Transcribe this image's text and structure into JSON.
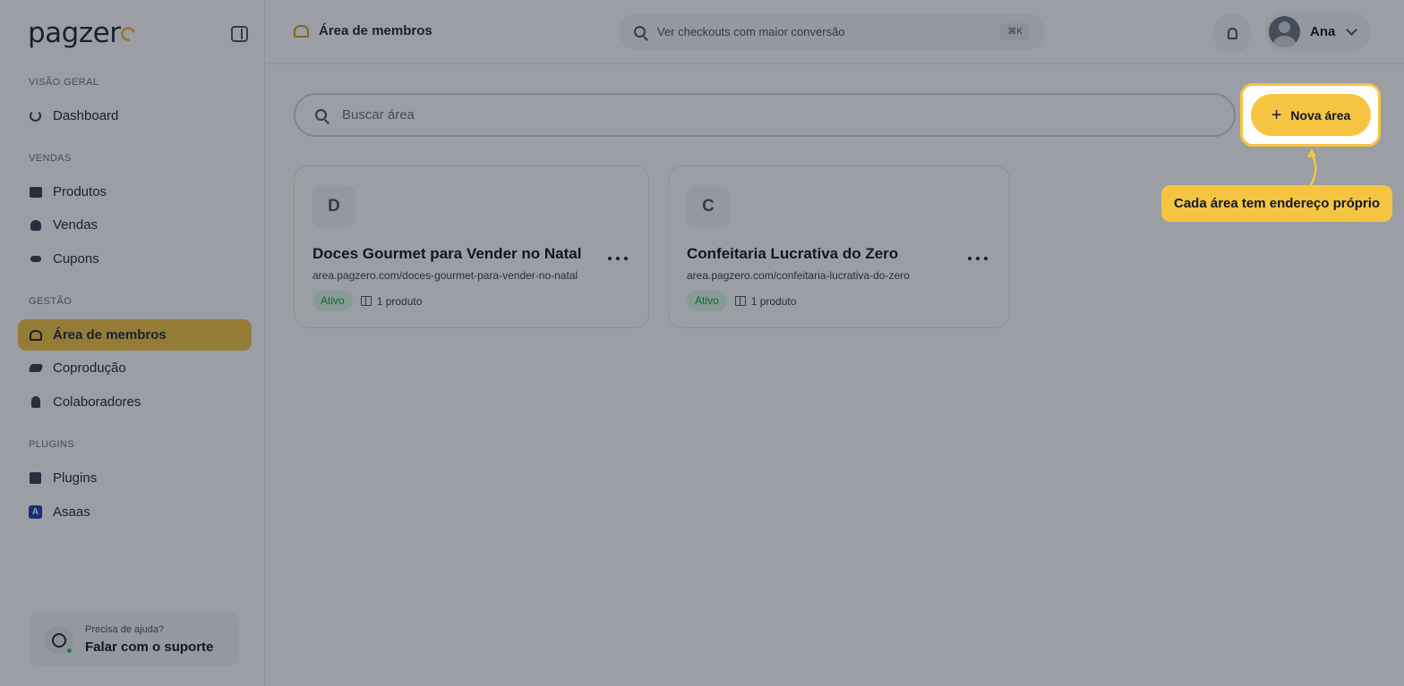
{
  "brand": {
    "logo_text": "pagzer",
    "accent_color": "#f5c542"
  },
  "sidebar": {
    "sections": {
      "overview": "VISÃO GERAL",
      "sales": "VENDAS",
      "management": "GESTÃO",
      "plugins": "PLUGINS"
    },
    "items": [
      {
        "label": "Dashboard",
        "icon": "chart-pie-icon"
      },
      {
        "label": "Produtos",
        "icon": "box-icon"
      },
      {
        "label": "Vendas",
        "icon": "sales-icon"
      },
      {
        "label": "Cupons",
        "icon": "ticket-icon"
      },
      {
        "label": "Área de membros",
        "icon": "users-icon",
        "active": true
      },
      {
        "label": "Coprodução",
        "icon": "handshake-icon"
      },
      {
        "label": "Colaboradores",
        "icon": "person-icon"
      },
      {
        "label": "Plugins",
        "icon": "puzzle-icon"
      },
      {
        "label": "Asaas",
        "icon": "asaas-icon",
        "icon_letter": "A"
      }
    ],
    "help": {
      "small": "Precisa de ajuda?",
      "big": "Falar com o suporte"
    }
  },
  "header": {
    "title": "Área de membros",
    "search_placeholder": "Ver checkouts com maior conversão",
    "shortcut": "⌘K",
    "user_name": "Ana"
  },
  "main": {
    "search_placeholder": "Buscar área",
    "new_button_label": "Nova área",
    "cards": [
      {
        "initial": "D",
        "title": "Doces Gourmet para Vender no Natal",
        "url": "area.pagzero.com/doces-gourmet-para-vender-no-natal",
        "status": "Ativo",
        "products": "1 produto"
      },
      {
        "initial": "C",
        "title": "Confeitaria Lucrativa do Zero",
        "url": "area.pagzero.com/confeitaria-lucrativa-do-zero",
        "status": "Ativo",
        "products": "1 produto"
      }
    ]
  },
  "tooltip": {
    "text": "Cada área tem endereço próprio"
  }
}
